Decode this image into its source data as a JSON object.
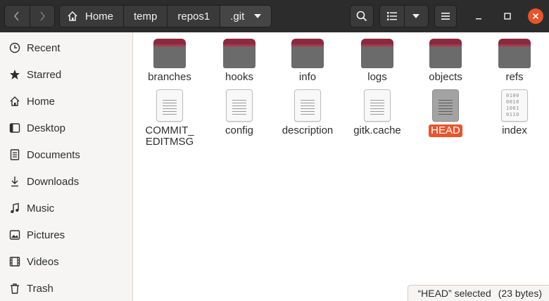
{
  "breadcrumbs": [
    "Home",
    "temp",
    "repos1",
    ".git"
  ],
  "sidebar": {
    "items": [
      {
        "label": "Recent",
        "icon": "clock-icon"
      },
      {
        "label": "Starred",
        "icon": "star-icon"
      },
      {
        "label": "Home",
        "icon": "home-icon"
      },
      {
        "label": "Desktop",
        "icon": "desktop-icon"
      },
      {
        "label": "Documents",
        "icon": "document-icon"
      },
      {
        "label": "Downloads",
        "icon": "download-icon"
      },
      {
        "label": "Music",
        "icon": "music-icon"
      },
      {
        "label": "Pictures",
        "icon": "picture-icon"
      },
      {
        "label": "Videos",
        "icon": "video-icon"
      },
      {
        "label": "Trash",
        "icon": "trash-icon"
      }
    ]
  },
  "files": [
    {
      "name": "branches",
      "type": "folder"
    },
    {
      "name": "hooks",
      "type": "folder"
    },
    {
      "name": "info",
      "type": "folder"
    },
    {
      "name": "logs",
      "type": "folder"
    },
    {
      "name": "objects",
      "type": "folder"
    },
    {
      "name": "refs",
      "type": "folder"
    },
    {
      "name": "COMMIT_\nEDITMSG",
      "type": "text"
    },
    {
      "name": "config",
      "type": "text"
    },
    {
      "name": "description",
      "type": "text"
    },
    {
      "name": "gitk.cache",
      "type": "text"
    },
    {
      "name": "HEAD",
      "type": "text",
      "selected": true
    },
    {
      "name": "index",
      "type": "binary"
    }
  ],
  "status": {
    "selected_text": "“HEAD” selected",
    "size_text": "(23 bytes)"
  },
  "colors": {
    "accent": "#e9542c",
    "headerbar": "#2c2c2c",
    "folder_tab": "#8a2a3e",
    "folder_body": "#6b6b6b"
  }
}
